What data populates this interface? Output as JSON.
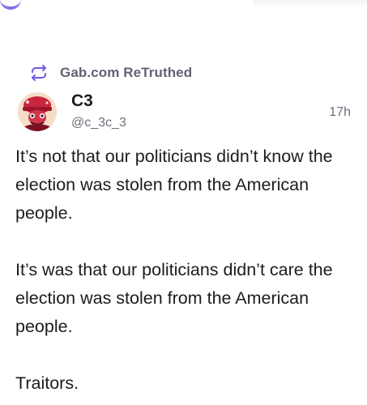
{
  "post": {
    "retruth_label": "Gab.com ReTruthed",
    "author": {
      "display_name": "C3",
      "handle": "@c_3c_3"
    },
    "timestamp": "17h",
    "body": {
      "paragraph_1": "It’s not that our politicians didn’t know the election was stolen from the American people.",
      "paragraph_2": "It’s was that our politicians didn’t care the election was stolen from the American people.",
      "paragraph_3": "Traitors."
    }
  },
  "icons": {
    "retruth": "retruth-icon",
    "avatar": "avatar-image"
  },
  "colors": {
    "accent": "#6d5ce8",
    "secondary_text": "#5e6272",
    "primary_text": "#1c1c21"
  }
}
